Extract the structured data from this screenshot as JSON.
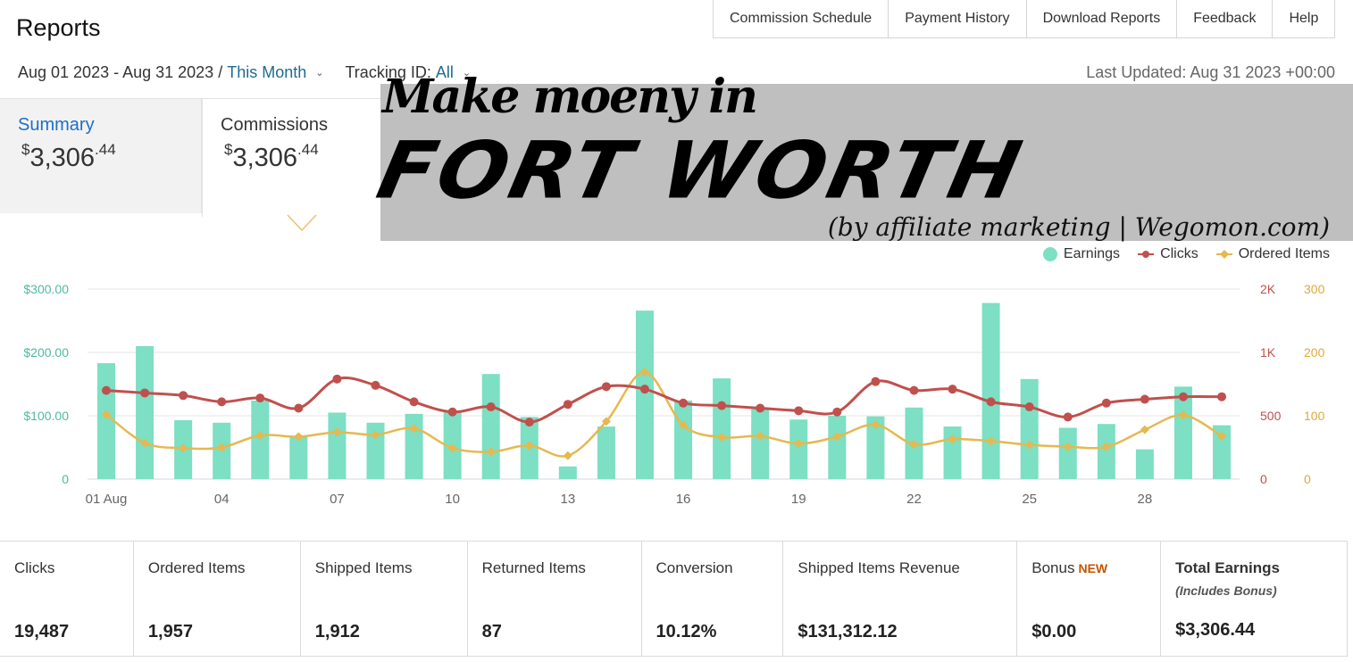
{
  "header": {
    "title": "Reports",
    "nav": [
      "Commission Schedule",
      "Payment History",
      "Download Reports",
      "Feedback",
      "Help"
    ]
  },
  "filters": {
    "date_range": "Aug 01 2023 - Aug 31 2023",
    "separator": " / ",
    "period": "This Month",
    "tracking_label": "Tracking ID: ",
    "tracking_value": "All",
    "last_updated": "Last Updated: Aug 31 2023 +00:00"
  },
  "tabs": [
    {
      "label": "Summary",
      "currency": "$",
      "amount_main": "3,306",
      "amount_cents": ".44",
      "active": true
    },
    {
      "label": "Commissions",
      "currency": "$",
      "amount_main": "3,306",
      "amount_cents": ".44",
      "active": false
    }
  ],
  "banner": {
    "script_text": "Make moeny in",
    "headline": "FORT WORTH",
    "tagline": "(by affiliate marketing | Wegomon.com)",
    "background": "#bfbfbf"
  },
  "chart_data": {
    "type": "bar",
    "x": [
      "01 Aug",
      "02",
      "03",
      "04",
      "05",
      "06",
      "07",
      "08",
      "09",
      "10",
      "11",
      "12",
      "13",
      "14",
      "15",
      "16",
      "17",
      "18",
      "19",
      "20",
      "21",
      "22",
      "23",
      "24",
      "25",
      "26",
      "27",
      "28",
      "29",
      "30"
    ],
    "x_tick_labels": [
      "01 Aug",
      "04",
      "07",
      "10",
      "13",
      "16",
      "19",
      "22",
      "25",
      "28"
    ],
    "series": [
      {
        "name": "Earnings",
        "kind": "bar",
        "axis": "left",
        "color": "#7ddfc3",
        "values": [
          183,
          210,
          93,
          89,
          124,
          68,
          105,
          89,
          103,
          106,
          166,
          98,
          20,
          83,
          266,
          124,
          159,
          111,
          94,
          100,
          99,
          113,
          83,
          278,
          158,
          81,
          87,
          47,
          146,
          85
        ]
      },
      {
        "name": "Clicks",
        "kind": "line",
        "axis": "right1",
        "color": "#c0504d",
        "values": [
          700,
          680,
          660,
          610,
          640,
          560,
          790,
          740,
          610,
          530,
          570,
          450,
          590,
          730,
          710,
          600,
          580,
          560,
          540,
          530,
          770,
          700,
          710,
          610,
          570,
          490,
          600,
          630,
          650,
          650
        ]
      },
      {
        "name": "Ordered Items",
        "kind": "line",
        "axis": "right2",
        "color": "#e6b84f",
        "values": [
          102,
          57,
          49,
          50,
          69,
          67,
          74,
          70,
          80,
          49,
          43,
          53,
          37,
          91,
          169,
          85,
          66,
          68,
          56,
          67,
          86,
          55,
          63,
          60,
          54,
          51,
          51,
          78,
          101,
          68
        ]
      }
    ],
    "y_left": {
      "ticks": [
        "0",
        "$100.00",
        "$200.00",
        "$300.00"
      ],
      "range": [
        0,
        300
      ]
    },
    "y_right1": {
      "ticks": [
        "0",
        "500",
        "1K",
        "2K"
      ],
      "range": [
        0,
        1500
      ]
    },
    "y_right2": {
      "ticks": [
        "0",
        "100",
        "200",
        "300"
      ],
      "range": [
        0,
        300
      ]
    },
    "legend_position": "top-right",
    "grid": "horizontal"
  },
  "stats": [
    {
      "label": "Clicks",
      "value": "19,487"
    },
    {
      "label": "Ordered Items",
      "value": "1,957"
    },
    {
      "label": "Shipped Items",
      "value": "1,912"
    },
    {
      "label": "Returned Items",
      "value": "87"
    },
    {
      "label": "Conversion",
      "value": "10.12%"
    },
    {
      "label": "Shipped Items Revenue",
      "value": "$131,312.12"
    },
    {
      "label": "Bonus",
      "badge": "NEW",
      "value": "$0.00"
    },
    {
      "label": "Total Earnings",
      "sublabel": "(Includes Bonus)",
      "value": "$3,306.44"
    }
  ]
}
